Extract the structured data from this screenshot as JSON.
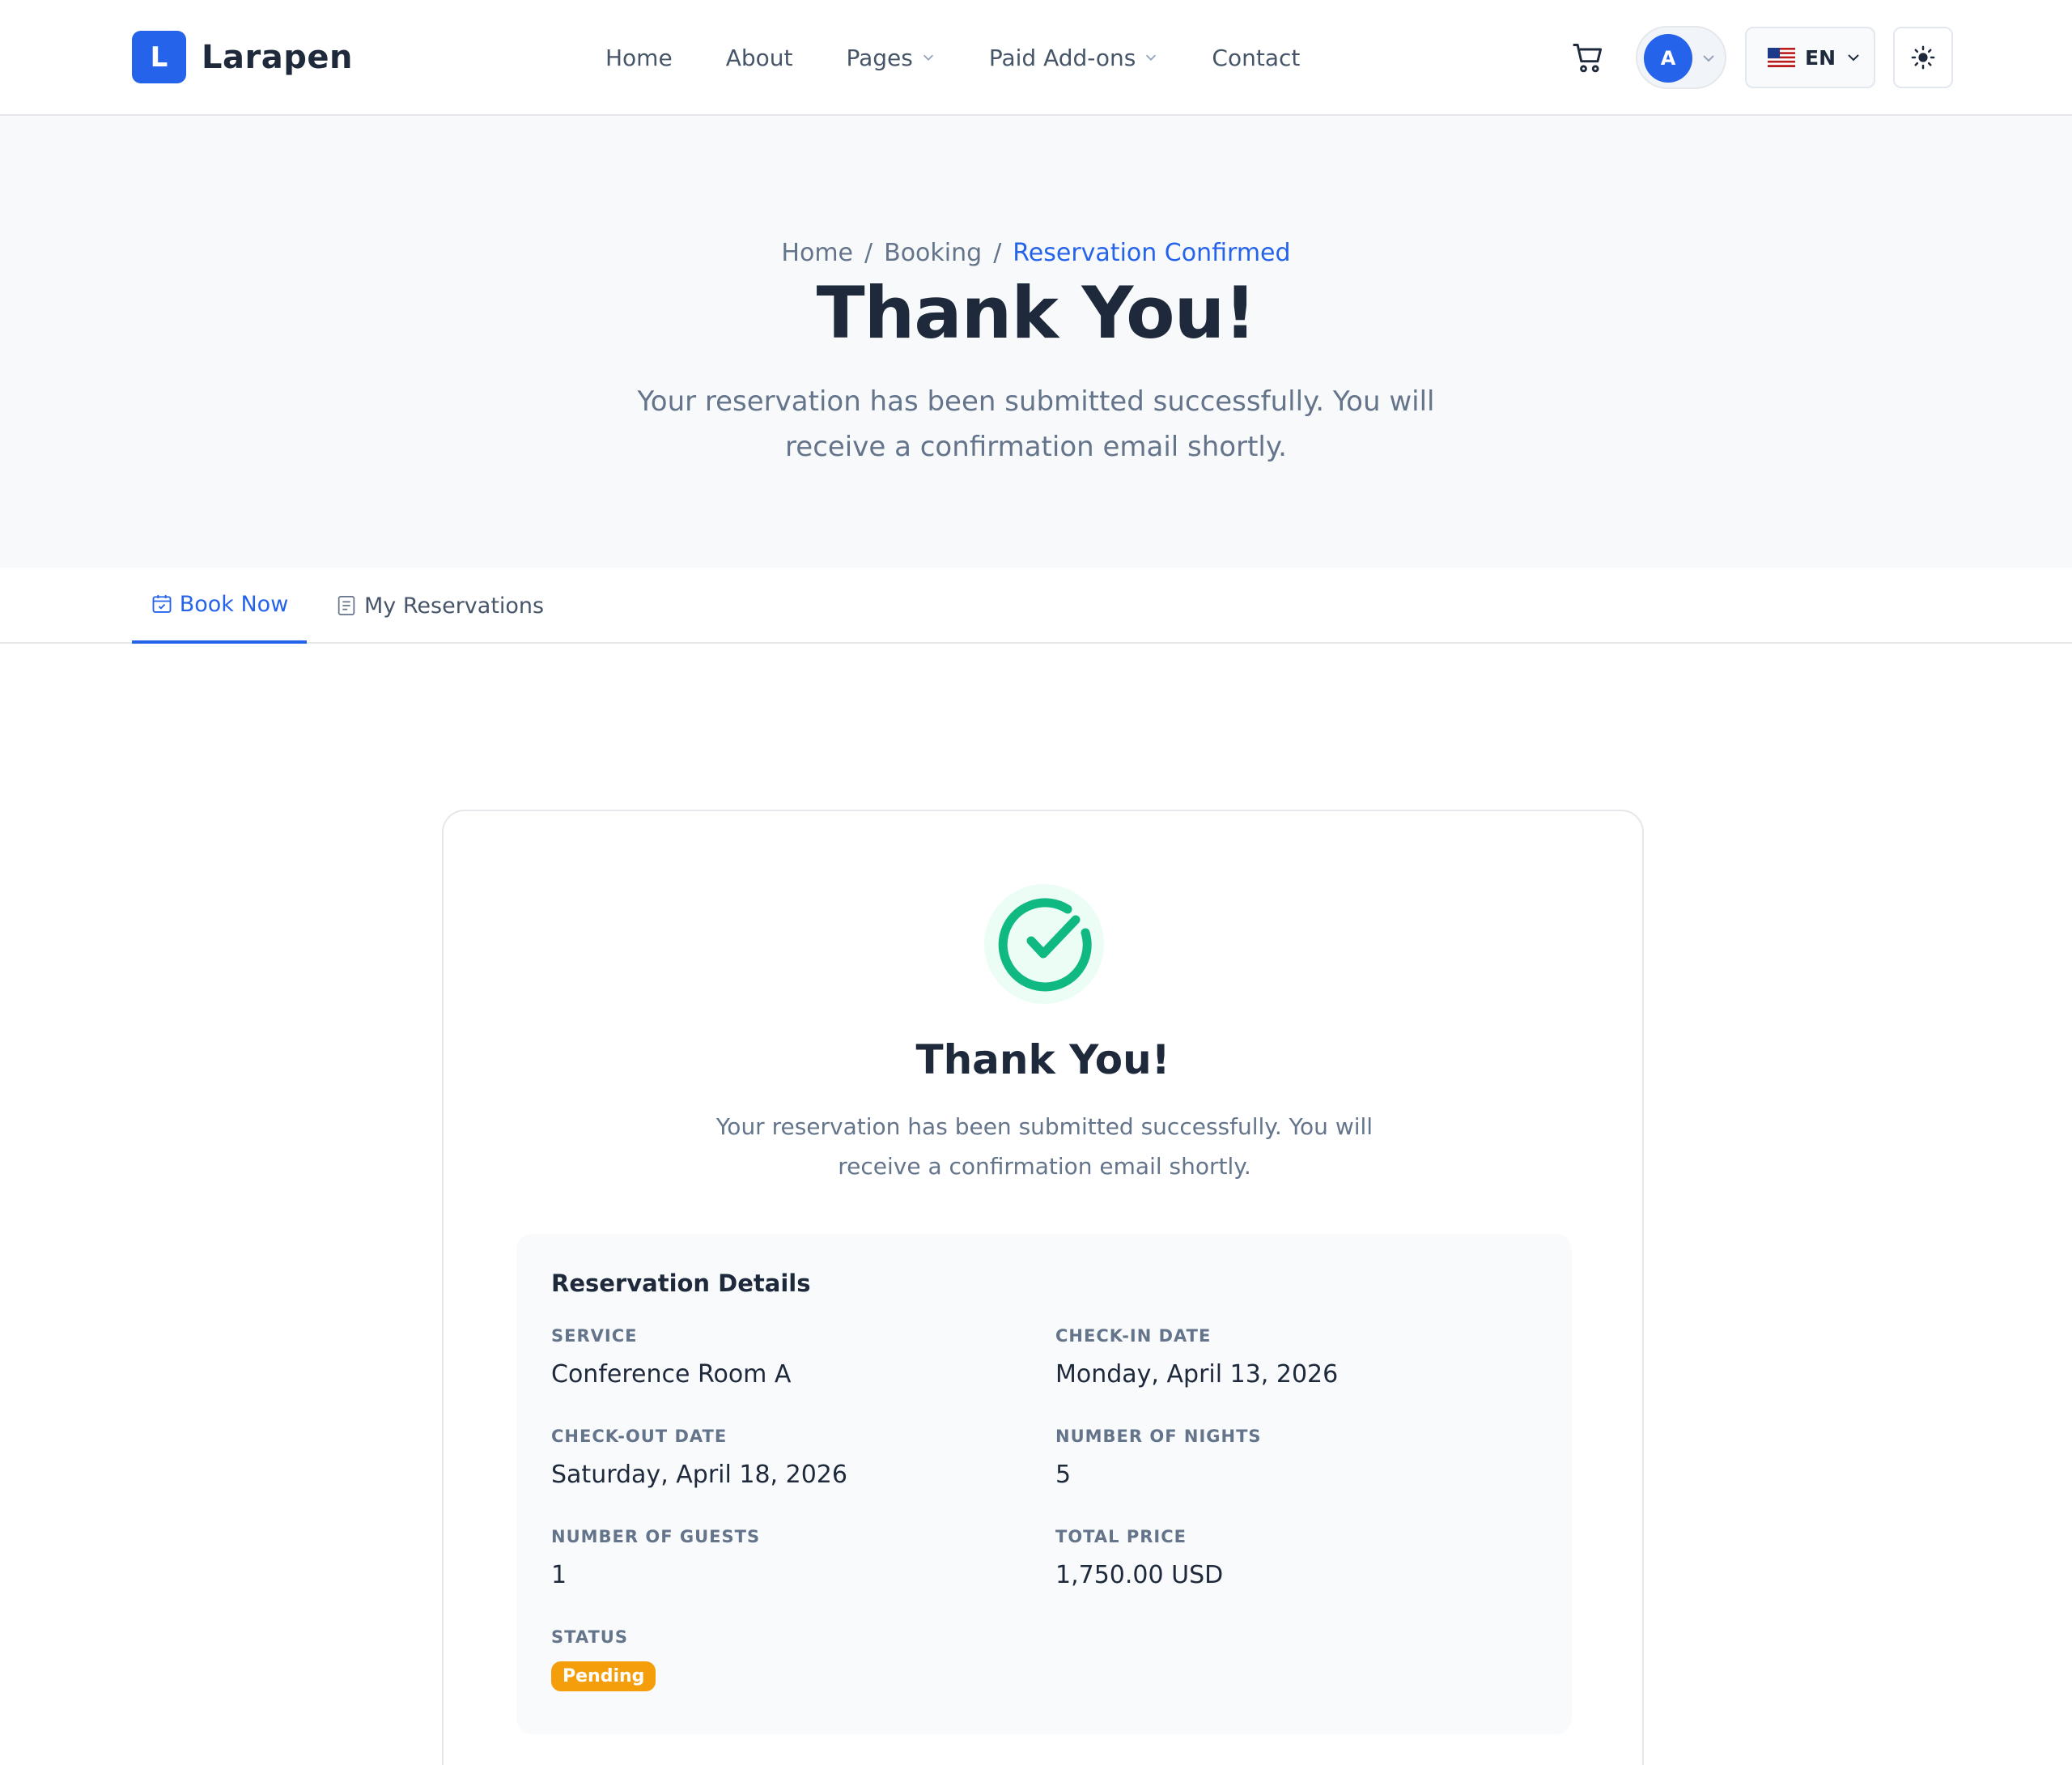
{
  "header": {
    "logo_letter": "L",
    "brand": "Larapen",
    "nav": [
      {
        "label": "Home",
        "dropdown": false
      },
      {
        "label": "About",
        "dropdown": false
      },
      {
        "label": "Pages",
        "dropdown": true
      },
      {
        "label": "Paid Add-ons",
        "dropdown": true
      },
      {
        "label": "Contact",
        "dropdown": false
      }
    ],
    "cart_icon": "cart-icon",
    "avatar_letter": "A",
    "language": "EN",
    "theme_icon": "sun-icon"
  },
  "hero": {
    "breadcrumb": [
      "Home",
      "Booking",
      "Reservation Confirmed"
    ],
    "title": "Thank You!",
    "subtitle": "Your reservation has been submitted successfully. You will receive a confirmation email shortly."
  },
  "tabs": [
    {
      "label": "Book Now",
      "active": true,
      "icon": "calendar-check-icon"
    },
    {
      "label": "My Reservations",
      "active": false,
      "icon": "list-icon"
    }
  ],
  "card": {
    "icon": "check-circle-icon",
    "title": "Thank You!",
    "message": "Your reservation has been submitted successfully. You will receive a confirmation email shortly.",
    "details": {
      "title": "Reservation Details",
      "service_label": "Service",
      "service": "Conference Room A",
      "checkin_label": "Check-in Date",
      "checkin": "Monday, April 13, 2026",
      "checkout_label": "Check-out Date",
      "checkout": "Saturday, April 18, 2026",
      "nights_label": "Number of Nights",
      "nights": "5",
      "guests_label": "Number of Guests",
      "guests": "1",
      "price_label": "Total Price",
      "price": "1,750.00 USD",
      "status_label": "Status",
      "status": "Pending"
    }
  },
  "colors": {
    "primary": "#2563eb",
    "success": "#10b981",
    "warning": "#f59e0b",
    "heading": "#1e293b",
    "muted": "#64748b"
  }
}
